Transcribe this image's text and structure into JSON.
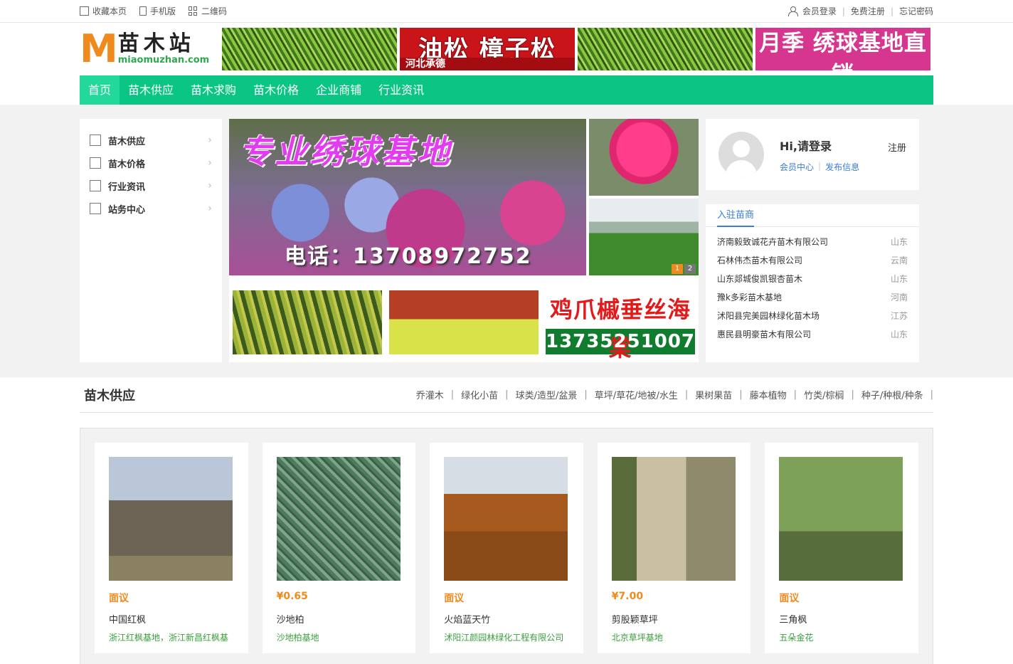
{
  "topbar": {
    "left": [
      {
        "label": "收藏本页",
        "icon": "bookmark-icon"
      },
      {
        "label": "手机版",
        "icon": "phone-icon"
      },
      {
        "label": "二维码",
        "icon": "qrcode-icon"
      }
    ],
    "right": {
      "login": "会员登录",
      "register": "免费注册",
      "forgot": "忘记密码",
      "sep": "|"
    }
  },
  "logo": {
    "m": "M",
    "cn": "苗木站",
    "en": "miaomuzhan.com"
  },
  "banners": {
    "red_big": "油松 樟子松",
    "red_small": "河北承德",
    "pink": "月季 绣球基地直销"
  },
  "nav": [
    "首页",
    "苗木供应",
    "苗木求购",
    "苗木价格",
    "企业商铺",
    "行业资讯"
  ],
  "sidebar": [
    {
      "label": "苗木供应"
    },
    {
      "label": "苗木价格"
    },
    {
      "label": "行业资讯"
    },
    {
      "label": "站务中心"
    }
  ],
  "carousel": {
    "headline": "专业绣球基地",
    "phone": "电话：13708972752",
    "dots": [
      "1",
      "2"
    ]
  },
  "thumb_ad": {
    "line1": "鸡爪槭垂丝海棠",
    "line2": "13735251007"
  },
  "login": {
    "hi": "Hi,请登录",
    "register": "注册",
    "member": "会员中心",
    "publish": "发布信息",
    "sep": "|"
  },
  "firms": {
    "tab": "入驻苗商",
    "list": [
      {
        "name": "济南毅致诚花卉苗木有限公司",
        "prov": "山东"
      },
      {
        "name": "石林伟杰苗木有限公司",
        "prov": "云南"
      },
      {
        "name": "山东郯城俊凯银杏苗木",
        "prov": "山东"
      },
      {
        "name": "豫k多彩苗木基地",
        "prov": "河南"
      },
      {
        "name": "沭阳县完美园林绿化苗木场",
        "prov": "江苏"
      },
      {
        "name": "惠民县明豪苗木有限公司",
        "prov": "山东"
      }
    ]
  },
  "supply": {
    "title": "苗木供应",
    "cats": [
      "乔灌木",
      "绿化小苗",
      "球类/造型/盆景",
      "草坪/草花/地被/水生",
      "果树果苗",
      "藤本植物",
      "竹类/棕榈",
      "种子/种根/种条"
    ],
    "products": [
      {
        "price": "面议",
        "name": "中国红枫",
        "company": "浙江红枫基地，浙江新昌红枫基"
      },
      {
        "price": "¥0.65",
        "name": "沙地柏",
        "company": "沙地柏基地"
      },
      {
        "price": "面议",
        "name": "火焰蓝天竹",
        "company": "沭阳江颜园林绿化工程有限公司"
      },
      {
        "price": "¥7.00",
        "name": "剪股颖草坪",
        "company": "北京草坪基地"
      },
      {
        "price": "面议",
        "name": "三角枫",
        "company": "五朵金花"
      }
    ]
  },
  "colors": {
    "nav": "#0bc584",
    "accent": "#f08a1c",
    "link": "#3a7bd5",
    "company": "#3a9f3a"
  }
}
